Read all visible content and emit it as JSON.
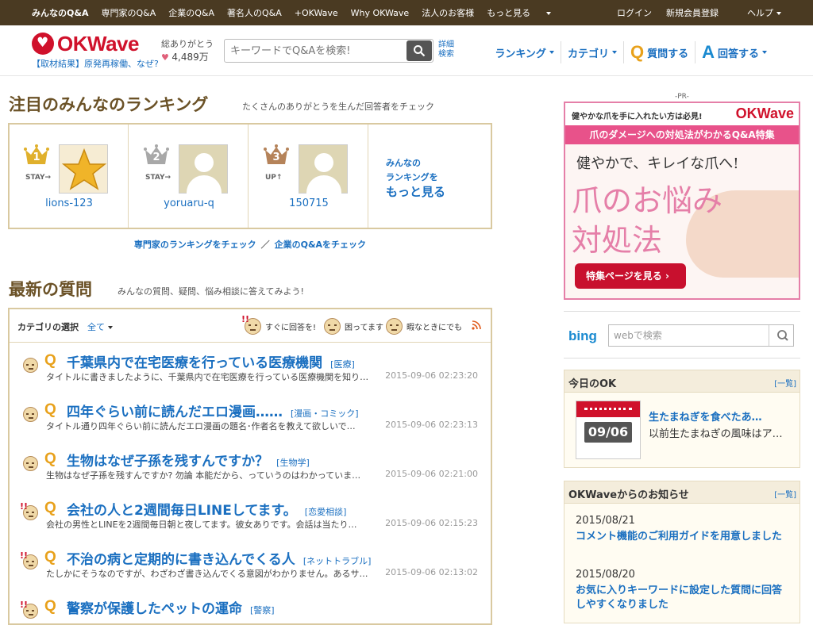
{
  "topbar": {
    "left": [
      "みんなのQ&A",
      "専門家のQ&A",
      "企業のQ&A",
      "著名人のQ&A",
      "+OKWave",
      "Why OKWave",
      "法人のお客様",
      "もっと見る"
    ],
    "right": [
      "ログイン",
      "新規会員登録",
      "ヘルプ"
    ]
  },
  "header": {
    "logo": "OKWave",
    "news_link": "【取材結果】原発再稼働、なぜ?",
    "thanks_label": "総ありがとう",
    "thanks_count": "4,489万",
    "search_placeholder": "キーワードでQ&Aを検索!",
    "advanced_search_1": "詳細",
    "advanced_search_2": "検索",
    "nav": {
      "ranking": "ランキング",
      "category": "カテゴリ",
      "ask": "質問する",
      "answer": "回答する",
      "ask_icon": "Q",
      "answer_icon": "A"
    }
  },
  "ranking": {
    "title": "注目のみんなのランキング",
    "subtitle": "たくさんのありがとうを生んだ回答者をチェック",
    "entries": [
      {
        "rank": "1",
        "status": "STAY→",
        "user": "lions-123",
        "crown_color": "#e0b02c"
      },
      {
        "rank": "2",
        "status": "STAY→",
        "user": "yoruaru-q",
        "crown_color": "#a8a8a8"
      },
      {
        "rank": "3",
        "status": "UP↑",
        "user": "150715",
        "crown_color": "#b5835a"
      }
    ],
    "more_1": "みんなの",
    "more_2": "ランキングを",
    "more_3": "もっと見る",
    "link_expert": "専門家のランキングをチェック",
    "link_sep": "／",
    "link_company": "企業のQ&Aをチェック"
  },
  "latest": {
    "title": "最新の質問",
    "subtitle": "みんなの質問、疑問、悩み相談に答えてみよう!",
    "category_label": "カテゴリの選択",
    "category_value": "全て",
    "filters": [
      "すぐに回答を!",
      "困ってます",
      "暇なときにでも"
    ],
    "questions": [
      {
        "q": "Q",
        "title": "千葉県内で在宅医療を行っている医療機関",
        "tag": "[医療]",
        "body": "タイトルに書きましたように、千葉県内で在宅医療を行っている医療機関を知り…",
        "time": "2015-09-06 02:23:20"
      },
      {
        "q": "Q",
        "title": "四年ぐらい前に読んだエロ漫画……",
        "tag": "[漫画・コミック]",
        "body": "タイトル通り四年ぐらい前に読んだエロ漫画の題名･作者名を教えて欲しいで…",
        "time": "2015-09-06 02:23:13"
      },
      {
        "q": "Q",
        "title": "生物はなぜ子孫を残すんですか？",
        "tag": "[生物学]",
        "body": "生物はなぜ子孫を残すんですか? 勿論 本能だから、っていうのはわかっていま…",
        "time": "2015-09-06 02:21:00"
      },
      {
        "q": "Q",
        "title": "会社の人と2週間毎日LINEしてます。",
        "tag": "[恋愛相談]",
        "body": "会社の男性とLINEを2週間毎日朝と夜してます。彼女ありです。会話は当たり…",
        "time": "2015-09-06 02:15:23"
      },
      {
        "q": "Q",
        "title": "不治の病と定期的に書き込んでくる人",
        "tag": "[ネットトラブル]",
        "body": "たしかにそうなのですが、わざわざ書き込んでくる意図がわかりません。あるサ…",
        "time": "2015-09-06 02:13:02"
      },
      {
        "q": "Q",
        "title": "警察が保護したペットの運命",
        "tag": "[警察]",
        "body": "",
        "time": ""
      }
    ]
  },
  "ad": {
    "pr": "-PR-",
    "top": "健やかな爪を手に入れたい方は必見!",
    "top_logo": "OKWave",
    "band": "爪のダメージへの対処法がわかるQ&A特集",
    "line1": "健やかで、キレイな爪へ!",
    "line2": "爪のお悩み",
    "line3": "対処法",
    "button": "特集ページを見る ›"
  },
  "bing": {
    "logo": "bing",
    "placeholder": "webで検索"
  },
  "today": {
    "title": "今日のOK",
    "more": "[一覧]",
    "date": "09/06",
    "q_title": "生たまねぎを食べたあ…",
    "q_body": "以前生たまねぎの風味はア…"
  },
  "news": {
    "title": "OKWaveからのお知らせ",
    "more": "[一覧]",
    "items": [
      {
        "date": "2015/08/21",
        "title": "コメント機能のご利用ガイドを用意しました"
      },
      {
        "date": "2015/08/20",
        "title": "お気に入りキーワードに設定した質問に回答しやすくなりました"
      }
    ]
  }
}
